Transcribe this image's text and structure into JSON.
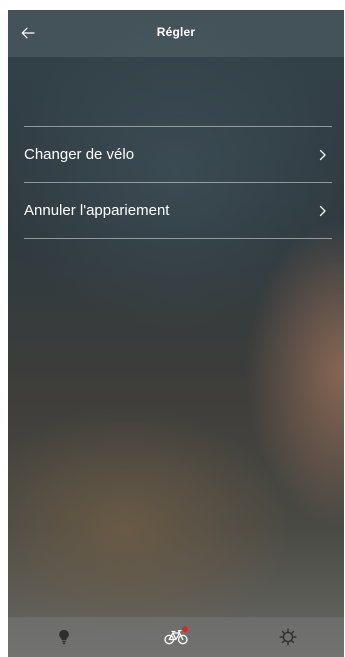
{
  "header": {
    "title": "Régler",
    "back_icon": "arrow-left-icon"
  },
  "menu": {
    "items": [
      {
        "label": "Changer de vélo",
        "icon": "chevron-right-icon"
      },
      {
        "label": "Annuler l'appariement",
        "icon": "chevron-right-icon"
      }
    ]
  },
  "tabbar": {
    "tabs": [
      {
        "icon": "lightbulb-icon",
        "active": false
      },
      {
        "icon": "bicycle-icon",
        "active": true,
        "badge": true
      },
      {
        "icon": "gear-icon",
        "active": false
      }
    ]
  },
  "colors": {
    "badge": "#e0252e",
    "text": "#ffffff"
  }
}
